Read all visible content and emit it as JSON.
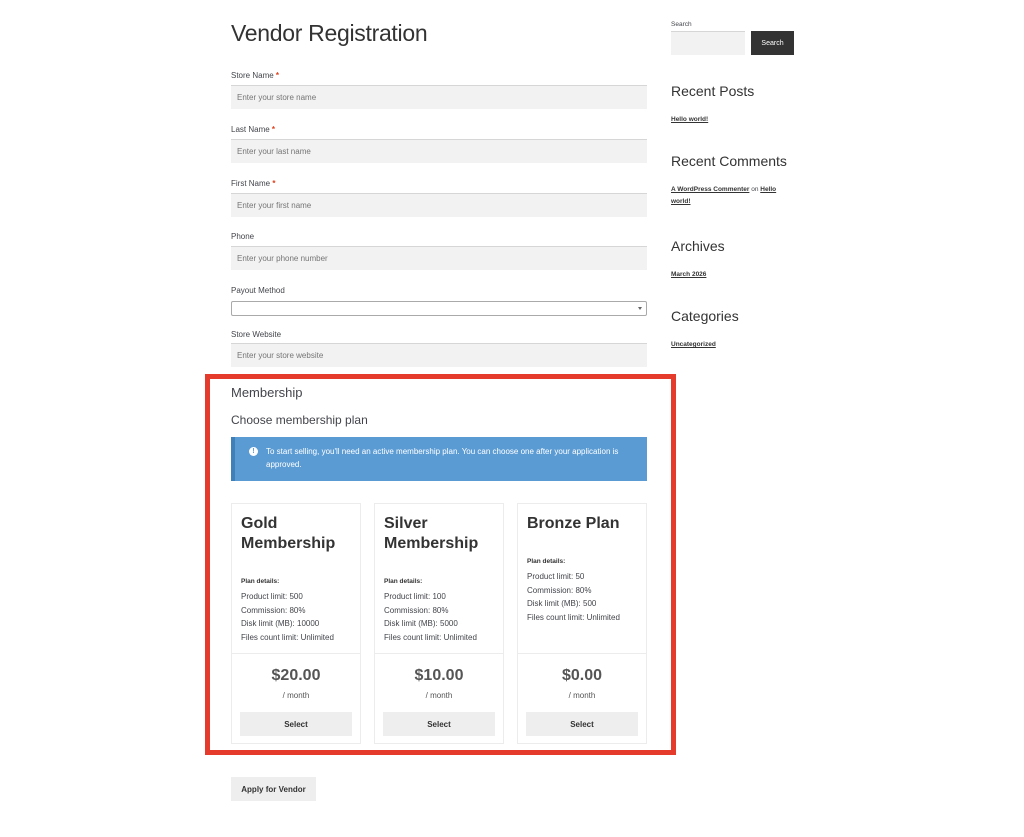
{
  "page": {
    "title": "Vendor Registration"
  },
  "form": {
    "store_name": {
      "label": "Store Name",
      "placeholder": "Enter your store name"
    },
    "last_name": {
      "label": "Last Name",
      "placeholder": "Enter your last name"
    },
    "first_name": {
      "label": "First Name",
      "placeholder": "Enter your first name"
    },
    "phone": {
      "label": "Phone",
      "placeholder": "Enter your phone number"
    },
    "payout_method": {
      "label": "Payout Method",
      "value": ""
    },
    "store_website": {
      "label": "Store Website",
      "placeholder": "Enter your store website"
    },
    "required_mark": "*"
  },
  "membership": {
    "heading": "Membership",
    "subheading": "Choose membership plan",
    "notice": "To start selling, you'll need an active membership plan. You can choose one after your application is approved.",
    "notice_icon": "info-icon",
    "plans": [
      {
        "name": "Gold Membership",
        "details_label": "Plan details:",
        "lines": [
          "Product limit: 500",
          "Commission: 80%",
          "Disk limit (MB): 10000",
          "Files count limit: Unlimited"
        ],
        "price": "$20.00",
        "period": "/ month",
        "button": "Select"
      },
      {
        "name": "Silver Membership",
        "details_label": "Plan details:",
        "lines": [
          "Product limit: 100",
          "Commission: 80%",
          "Disk limit (MB): 5000",
          "Files count limit: Unlimited"
        ],
        "price": "$10.00",
        "period": "/ month",
        "button": "Select"
      },
      {
        "name": "Bronze Plan",
        "details_label": "Plan details:",
        "lines": [
          "Product limit: 50",
          "Commission: 80%",
          "Disk limit (MB): 500",
          "Files count limit: Unlimited"
        ],
        "price": "$0.00",
        "period": "/ month",
        "button": "Select"
      }
    ]
  },
  "apply_button": "Apply for Vendor",
  "sidebar": {
    "search_label": "Search",
    "search_button": "Search",
    "recent_posts": {
      "title": "Recent Posts",
      "links": [
        "Hello world!"
      ]
    },
    "recent_comments": {
      "title": "Recent Comments",
      "author": "A WordPress Commenter",
      "on": "on",
      "post": "Hello world!"
    },
    "archives": {
      "title": "Archives",
      "links": [
        "March 2026"
      ]
    },
    "categories": {
      "title": "Categories",
      "links": [
        "Uncategorized"
      ]
    }
  },
  "colors": {
    "highlight": "#e53b2c",
    "notice": "#5a9bd4",
    "required": "#e2401c"
  }
}
